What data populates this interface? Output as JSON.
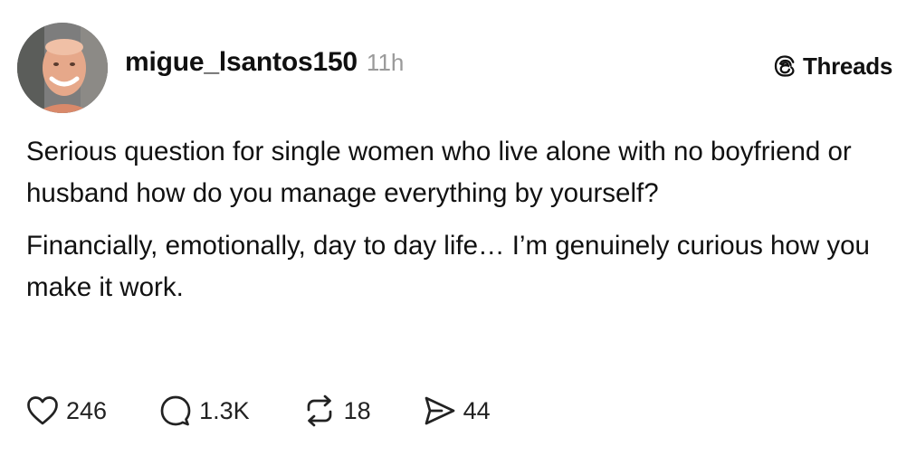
{
  "post": {
    "author": {
      "username": "migue_lsantos150",
      "avatar_icon": "profile-photo"
    },
    "timestamp": "11h",
    "platform": {
      "label": "Threads",
      "icon": "threads-logo-icon"
    },
    "paragraphs": [
      "Serious question for single women who live alone with no boyfriend or husband how do you manage everything by yourself?",
      "Financially, emotionally, day to day life… I’m genuinely curious how you make it work."
    ],
    "actions": {
      "likes": "246",
      "replies": "1.3K",
      "reposts": "18",
      "shares": "44"
    }
  }
}
